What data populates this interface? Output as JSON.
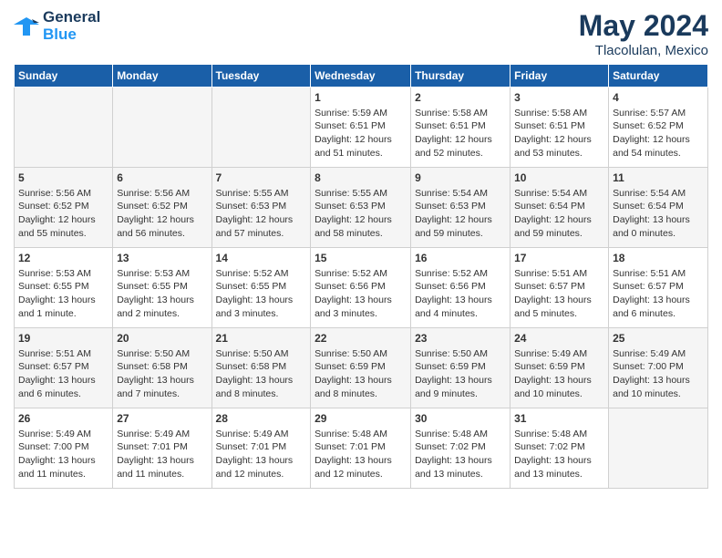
{
  "logo": {
    "line1": "General",
    "line2": "Blue"
  },
  "title": "May 2024",
  "location": "Tlacolulan, Mexico",
  "days_header": [
    "Sunday",
    "Monday",
    "Tuesday",
    "Wednesday",
    "Thursday",
    "Friday",
    "Saturday"
  ],
  "weeks": [
    [
      {
        "day": "",
        "content": ""
      },
      {
        "day": "",
        "content": ""
      },
      {
        "day": "",
        "content": ""
      },
      {
        "day": "1",
        "content": "Sunrise: 5:59 AM\nSunset: 6:51 PM\nDaylight: 12 hours\nand 51 minutes."
      },
      {
        "day": "2",
        "content": "Sunrise: 5:58 AM\nSunset: 6:51 PM\nDaylight: 12 hours\nand 52 minutes."
      },
      {
        "day": "3",
        "content": "Sunrise: 5:58 AM\nSunset: 6:51 PM\nDaylight: 12 hours\nand 53 minutes."
      },
      {
        "day": "4",
        "content": "Sunrise: 5:57 AM\nSunset: 6:52 PM\nDaylight: 12 hours\nand 54 minutes."
      }
    ],
    [
      {
        "day": "5",
        "content": "Sunrise: 5:56 AM\nSunset: 6:52 PM\nDaylight: 12 hours\nand 55 minutes."
      },
      {
        "day": "6",
        "content": "Sunrise: 5:56 AM\nSunset: 6:52 PM\nDaylight: 12 hours\nand 56 minutes."
      },
      {
        "day": "7",
        "content": "Sunrise: 5:55 AM\nSunset: 6:53 PM\nDaylight: 12 hours\nand 57 minutes."
      },
      {
        "day": "8",
        "content": "Sunrise: 5:55 AM\nSunset: 6:53 PM\nDaylight: 12 hours\nand 58 minutes."
      },
      {
        "day": "9",
        "content": "Sunrise: 5:54 AM\nSunset: 6:53 PM\nDaylight: 12 hours\nand 59 minutes."
      },
      {
        "day": "10",
        "content": "Sunrise: 5:54 AM\nSunset: 6:54 PM\nDaylight: 12 hours\nand 59 minutes."
      },
      {
        "day": "11",
        "content": "Sunrise: 5:54 AM\nSunset: 6:54 PM\nDaylight: 13 hours\nand 0 minutes."
      }
    ],
    [
      {
        "day": "12",
        "content": "Sunrise: 5:53 AM\nSunset: 6:55 PM\nDaylight: 13 hours\nand 1 minute."
      },
      {
        "day": "13",
        "content": "Sunrise: 5:53 AM\nSunset: 6:55 PM\nDaylight: 13 hours\nand 2 minutes."
      },
      {
        "day": "14",
        "content": "Sunrise: 5:52 AM\nSunset: 6:55 PM\nDaylight: 13 hours\nand 3 minutes."
      },
      {
        "day": "15",
        "content": "Sunrise: 5:52 AM\nSunset: 6:56 PM\nDaylight: 13 hours\nand 3 minutes."
      },
      {
        "day": "16",
        "content": "Sunrise: 5:52 AM\nSunset: 6:56 PM\nDaylight: 13 hours\nand 4 minutes."
      },
      {
        "day": "17",
        "content": "Sunrise: 5:51 AM\nSunset: 6:57 PM\nDaylight: 13 hours\nand 5 minutes."
      },
      {
        "day": "18",
        "content": "Sunrise: 5:51 AM\nSunset: 6:57 PM\nDaylight: 13 hours\nand 6 minutes."
      }
    ],
    [
      {
        "day": "19",
        "content": "Sunrise: 5:51 AM\nSunset: 6:57 PM\nDaylight: 13 hours\nand 6 minutes."
      },
      {
        "day": "20",
        "content": "Sunrise: 5:50 AM\nSunset: 6:58 PM\nDaylight: 13 hours\nand 7 minutes."
      },
      {
        "day": "21",
        "content": "Sunrise: 5:50 AM\nSunset: 6:58 PM\nDaylight: 13 hours\nand 8 minutes."
      },
      {
        "day": "22",
        "content": "Sunrise: 5:50 AM\nSunset: 6:59 PM\nDaylight: 13 hours\nand 8 minutes."
      },
      {
        "day": "23",
        "content": "Sunrise: 5:50 AM\nSunset: 6:59 PM\nDaylight: 13 hours\nand 9 minutes."
      },
      {
        "day": "24",
        "content": "Sunrise: 5:49 AM\nSunset: 6:59 PM\nDaylight: 13 hours\nand 10 minutes."
      },
      {
        "day": "25",
        "content": "Sunrise: 5:49 AM\nSunset: 7:00 PM\nDaylight: 13 hours\nand 10 minutes."
      }
    ],
    [
      {
        "day": "26",
        "content": "Sunrise: 5:49 AM\nSunset: 7:00 PM\nDaylight: 13 hours\nand 11 minutes."
      },
      {
        "day": "27",
        "content": "Sunrise: 5:49 AM\nSunset: 7:01 PM\nDaylight: 13 hours\nand 11 minutes."
      },
      {
        "day": "28",
        "content": "Sunrise: 5:49 AM\nSunset: 7:01 PM\nDaylight: 13 hours\nand 12 minutes."
      },
      {
        "day": "29",
        "content": "Sunrise: 5:48 AM\nSunset: 7:01 PM\nDaylight: 13 hours\nand 12 minutes."
      },
      {
        "day": "30",
        "content": "Sunrise: 5:48 AM\nSunset: 7:02 PM\nDaylight: 13 hours\nand 13 minutes."
      },
      {
        "day": "31",
        "content": "Sunrise: 5:48 AM\nSunset: 7:02 PM\nDaylight: 13 hours\nand 13 minutes."
      },
      {
        "day": "",
        "content": ""
      }
    ]
  ]
}
